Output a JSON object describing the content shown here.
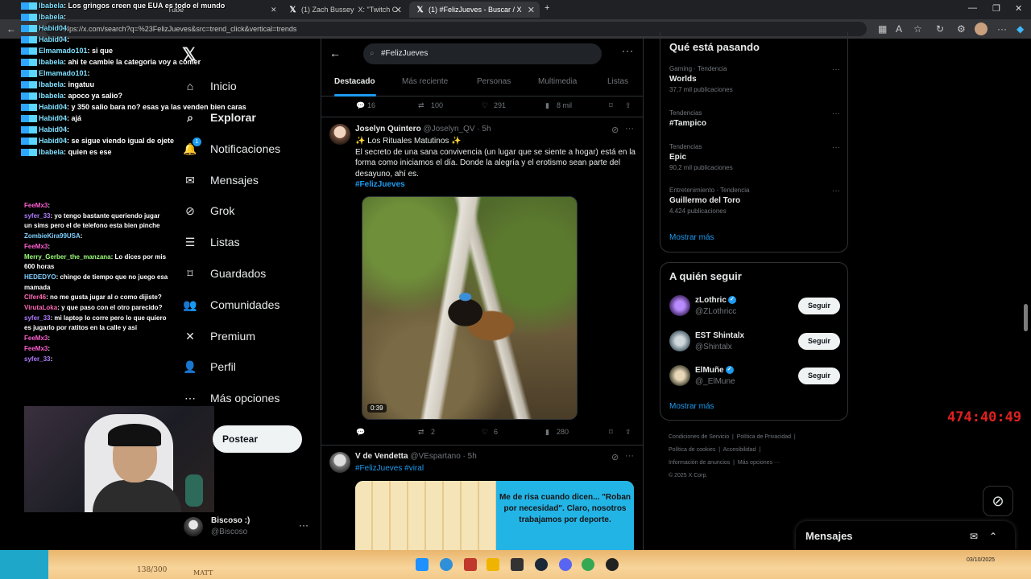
{
  "browser": {
    "tabs": [
      {
        "label": "Tube"
      },
      {
        "label": "(1) Zach Bussey"
      },
      {
        "label": "X: \"Twitch C"
      },
      {
        "label": "(1) #FelizJueves - Buscar / X"
      }
    ],
    "url": "https://x.com/search?q=%23FelizJueves&src=trend_click&vertical=trends"
  },
  "chat_top": [
    {
      "user": "Ibabela",
      "text": "Los gringos creen que EUA es todo el mundo"
    },
    {
      "user": "Ibabela",
      "text": ""
    },
    {
      "user": "Habid04",
      "text": ""
    },
    {
      "user": "Habid04",
      "text": ""
    },
    {
      "user": "Elmamado101",
      "text": "si que"
    },
    {
      "user": "Ibabela",
      "text": "ahi te cambie la categoria",
      "text2": "voy a comer"
    },
    {
      "user": "Elmamado101",
      "text": ""
    },
    {
      "user": "Ibabela",
      "text": "ingatuu"
    },
    {
      "user": "Ibabela",
      "text": "apoco ya salio?"
    },
    {
      "user": "Habid04",
      "text": "y 350 salio bara no? esas ya las venden bien",
      "text2": "caras"
    },
    {
      "user": "Habid04",
      "text": "ajá"
    },
    {
      "user": "Habid04",
      "text": ""
    },
    {
      "user": "Habid04",
      "text": "se sigue viendo igual de ojete"
    },
    {
      "user": "Ibabela",
      "text": "quien es ese"
    }
  ],
  "chat_bottom": [
    {
      "user": "FeeMx3",
      "text": ""
    },
    {
      "user": "syfer_33",
      "text": "yo tengo bastante queriendo jugar un sims pero el de telefono esta bien pinche"
    },
    {
      "user": "ZombieKira99USA",
      "text": ""
    },
    {
      "user": "FeeMx3",
      "text": ""
    },
    {
      "user": "Merry_Gerber_the_manzana",
      "text": "Lo dices por mis 600 horas"
    },
    {
      "user": "HEDEDYO",
      "text": "chingo de tiempo que no juego esa mamada"
    },
    {
      "user": "Clfer46",
      "text": "no me gusta jugar al",
      "text2": "o como dijiste?"
    },
    {
      "user": "VirutaLoka",
      "text": "y que paso con el otro parecido?"
    },
    {
      "user": "syfer_33",
      "text": "mi laptop lo corre pero lo que quiero es jugarlo por ratitos en la calle y asi"
    },
    {
      "user": "FeeMx3",
      "text": ""
    },
    {
      "user": "FeeMx3",
      "text": ""
    },
    {
      "user": "syfer_33",
      "text": ""
    }
  ],
  "nav": {
    "items": [
      {
        "label": "Inicio",
        "icon": "home-icon"
      },
      {
        "label": "Explorar",
        "icon": "search-icon"
      },
      {
        "label": "Notificaciones",
        "icon": "bell-icon",
        "badge": "1"
      },
      {
        "label": "Mensajes",
        "icon": "mail-icon"
      },
      {
        "label": "Grok",
        "icon": "grok-icon"
      },
      {
        "label": "Listas",
        "icon": "list-icon"
      },
      {
        "label": "Guardados",
        "icon": "bookmark-icon"
      },
      {
        "label": "Comunidades",
        "icon": "people-icon"
      },
      {
        "label": "Premium",
        "icon": "x-icon"
      },
      {
        "label": "Perfil",
        "icon": "person-icon"
      },
      {
        "label": "Más opciones",
        "icon": "more-circle-icon"
      }
    ],
    "post_label": "Postear",
    "profile": {
      "name": "Biscoso :)",
      "handle": "@Biscoso"
    }
  },
  "search": {
    "query": "#FelizJueves",
    "tabs": [
      "Destacado",
      "Más reciente",
      "Personas",
      "Multimedia",
      "Listas"
    ]
  },
  "top_actions": {
    "replies": "16",
    "reposts": "100",
    "likes": "291",
    "views": "8 mil"
  },
  "tweet1": {
    "name": "Joselyn Quintero",
    "handle": "@Joselyn_QV · 5h",
    "title": "✨ Los Rituales Matutinos ✨",
    "body": "El secreto de una sana convivencia (un lugar que se siente a hogar) está en la forma como iniciamos el día. Donde la alegría y el erotismo sean parte del desayuno, ahí es.",
    "hashtag": "#FelizJueves",
    "video_time": "0:39",
    "replies": "",
    "reposts": "2",
    "likes": "6",
    "views": "280"
  },
  "tweet2": {
    "name": "V de Vendetta",
    "handle": "@VEspartano · 5h",
    "hashtags": "#FelizJueves #viral",
    "comic_text": "Me de risa cuando dicen... \"Roban por necesidad\". Claro, nosotros trabajamos por deporte."
  },
  "trends": {
    "title": "Qué está pasando",
    "items": [
      {
        "category": "Gaming · Tendencia",
        "name": "Worlds",
        "count": "37,7 mil publicaciones"
      },
      {
        "category": "Tendencias",
        "name": "#Tampico",
        "count": ""
      },
      {
        "category": "Tendencias",
        "name": "Epic",
        "count": "90,2 mil publicaciones"
      },
      {
        "category": "Entretenimiento · Tendencia",
        "name": "Guillermo del Toro",
        "count": "4.424 publicaciones"
      }
    ],
    "more": "Mostrar más"
  },
  "who_to_follow": {
    "title": "A quién seguir",
    "items": [
      {
        "name": "zLothric",
        "handle": "@ZLothricc",
        "verified": true,
        "button": "Seguir"
      },
      {
        "name": "EST Shintalx",
        "handle": "@Shintalx",
        "verified": false,
        "button": "Seguir"
      },
      {
        "name": "ElMuñe",
        "handle": "@_ElMune",
        "verified": true,
        "button": "Seguir"
      }
    ],
    "more": "Mostrar más"
  },
  "footer": {
    "links": [
      "Condiciones de Servicio",
      "Política de Privacidad",
      "Política de cookies",
      "Accesibilidad",
      "Información de anuncios",
      "Más opciones ···"
    ],
    "copyright": "© 2025 X Corp."
  },
  "timer": "474:40:49",
  "messages_drawer": {
    "title": "Mensajes"
  },
  "taskbar": {
    "note1": "138/300",
    "note2": "MATT",
    "date": "03/10/2025"
  },
  "colors": {
    "accent": "#1d9bf0",
    "timer": "#e02020",
    "background": "#000000"
  }
}
